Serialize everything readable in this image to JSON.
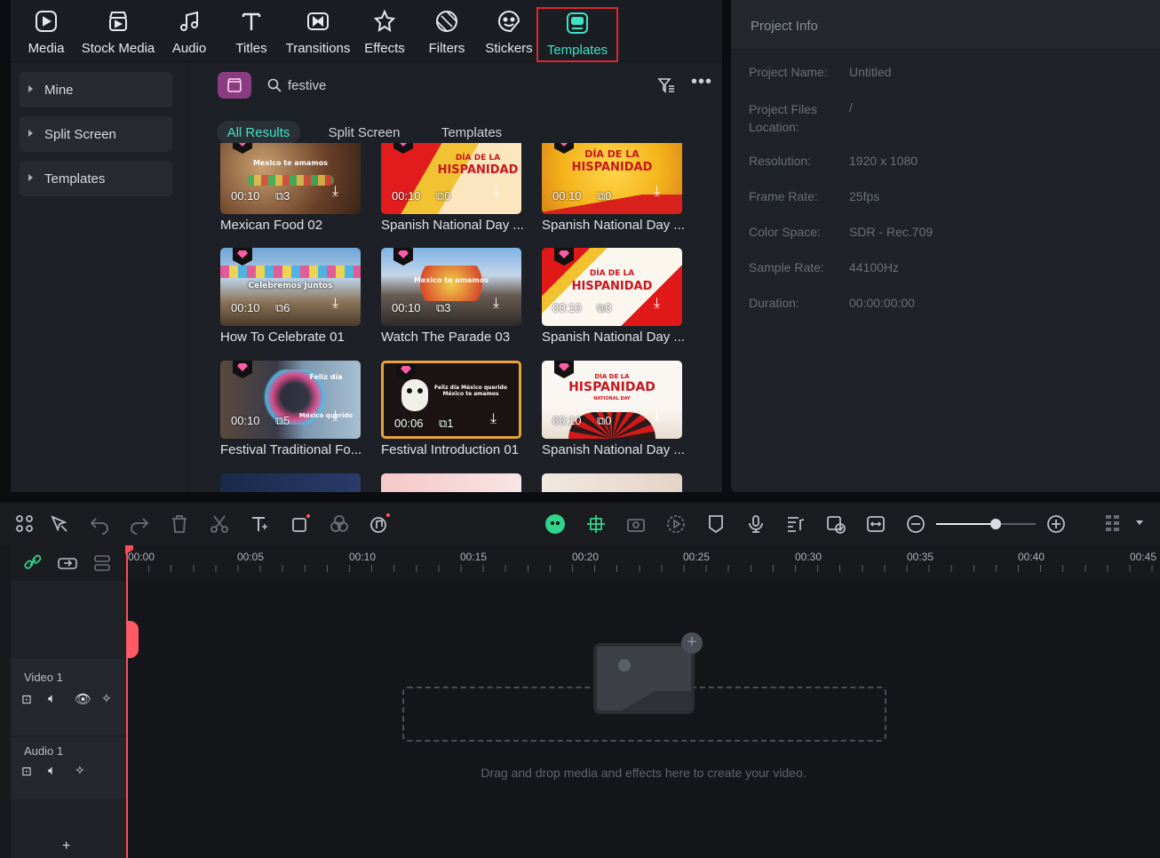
{
  "toolbar": [
    {
      "label": "Media",
      "icon": "media-icon"
    },
    {
      "label": "Stock Media",
      "icon": "stock-media-icon"
    },
    {
      "label": "Audio",
      "icon": "audio-icon"
    },
    {
      "label": "Titles",
      "icon": "titles-icon"
    },
    {
      "label": "Transitions",
      "icon": "transitions-icon"
    },
    {
      "label": "Effects",
      "icon": "effects-icon"
    },
    {
      "label": "Filters",
      "icon": "filters-icon"
    },
    {
      "label": "Stickers",
      "icon": "stickers-icon"
    },
    {
      "label": "Templates",
      "icon": "templates-icon",
      "active": true
    }
  ],
  "sidebar": {
    "items": [
      {
        "label": "Mine"
      },
      {
        "label": "Split Screen"
      },
      {
        "label": "Templates"
      }
    ]
  },
  "search": {
    "value": "festive"
  },
  "filter_tabs": [
    {
      "label": "All Results",
      "active": true
    },
    {
      "label": "Split Screen"
    },
    {
      "label": "Templates"
    }
  ],
  "cards": [
    {
      "title": "Mexican Food 02",
      "duration": "00:10",
      "count": "3"
    },
    {
      "title": "Spanish National Day ...",
      "duration": "00:10",
      "count": "0"
    },
    {
      "title": "Spanish National Day ...",
      "duration": "00:10",
      "count": "0"
    },
    {
      "title": "How To Celebrate 01",
      "duration": "00:10",
      "count": "6"
    },
    {
      "title": "Watch The Parade 03",
      "duration": "00:10",
      "count": "3"
    },
    {
      "title": "Spanish National Day ...",
      "duration": "00:10",
      "count": "0"
    },
    {
      "title": "Festival Traditional Fo...",
      "duration": "00:10",
      "count": "5"
    },
    {
      "title": "Festival Introduction 01",
      "duration": "00:06",
      "count": "1"
    },
    {
      "title": "Spanish National Day ...",
      "duration": "00:10",
      "count": "0"
    }
  ],
  "thumb_text": {
    "mexico_te_amamos": "Mexico te amamos",
    "dia_de_la": "DÍA DE LA",
    "hispanidad": "HISPANIDAD",
    "celebremos_juntos": "Celebremos Juntos",
    "feliz_dia": "Feliz día",
    "mexico_querido": "México querido",
    "feliz_dia_mexico_querido": "Feliz día México querido México te amamos",
    "national_day": "NATIONAL DAY"
  },
  "project_info": {
    "title": "Project Info",
    "rows": [
      {
        "label": "Project Name:",
        "value": "Untitled"
      },
      {
        "label": "Project Files Location:",
        "value": "/"
      },
      {
        "label": "Resolution:",
        "value": "1920 x 1080"
      },
      {
        "label": "Frame Rate:",
        "value": "25fps"
      },
      {
        "label": "Color Space:",
        "value": "SDR - Rec.709"
      },
      {
        "label": "Sample Rate:",
        "value": "44100Hz"
      },
      {
        "label": "Duration:",
        "value": "00:00:00:00"
      }
    ]
  },
  "ruler": [
    "00:00",
    "00:05",
    "00:10",
    "00:15",
    "00:20",
    "00:25",
    "00:30",
    "00:35",
    "00:40",
    "00:45"
  ],
  "tracks": [
    {
      "label": "Video 1"
    },
    {
      "label": "Audio 1"
    }
  ],
  "timeline": {
    "drop_hint": "Drag and drop media and effects here to create your video.",
    "zoom_level": 0.6
  },
  "colors": {
    "accent": "#3fe0c4",
    "highlight_border": "#e0262f",
    "playhead": "#ff4d5a"
  }
}
